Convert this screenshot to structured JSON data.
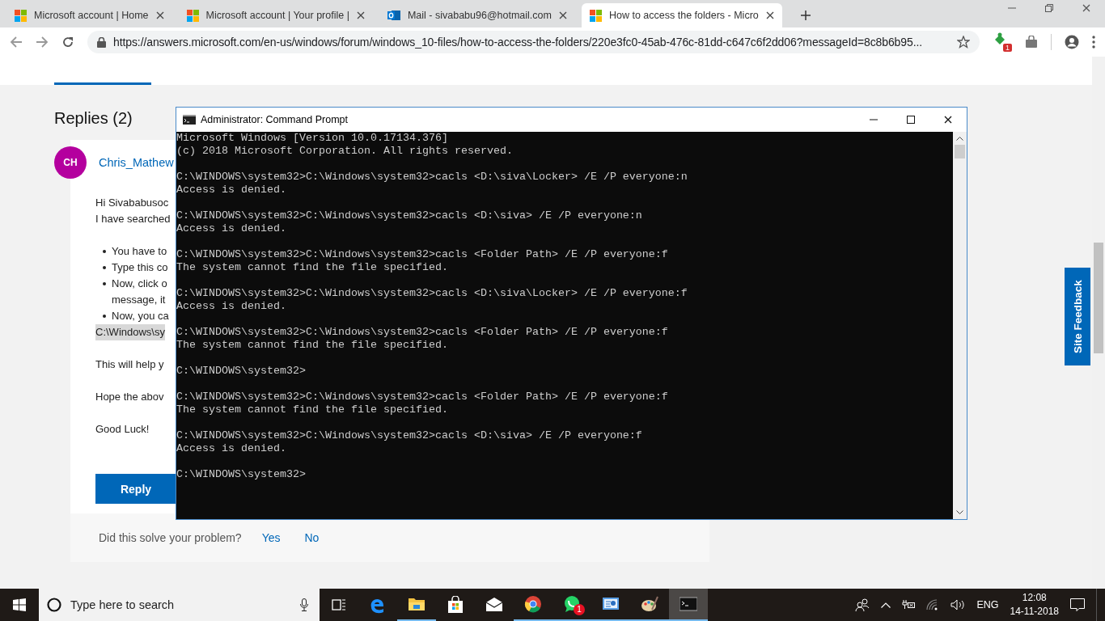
{
  "browser": {
    "tabs": [
      {
        "kind": "microsoft",
        "title": "Microsoft account | Home",
        "selected": false
      },
      {
        "kind": "microsoft",
        "title": "Microsoft account | Your profile |",
        "selected": false
      },
      {
        "kind": "mail",
        "title": "Mail - sivababu96@hotmail.com",
        "selected": false
      },
      {
        "kind": "microsoft",
        "title": "How to access the folders - Micro",
        "selected": true
      }
    ],
    "url": "https://answers.microsoft.com/en-us/windows/forum/windows_10-files/how-to-access-the-folders/220e3fc0-45ab-476c-81dd-c647c6f2dd06?messageId=8c8b6b95...",
    "extension_badge": "1"
  },
  "page": {
    "section_title": "Replies (2)",
    "reply": {
      "avatar_initials": "CH",
      "author": "Chris_Mathew",
      "blocks": [
        {
          "kind": "text",
          "lines": [
            "Hi Sivababusoc",
            "I have searched"
          ]
        },
        {
          "kind": "bullets",
          "items": [
            {
              "lines": [
                "You have to"
              ]
            },
            {
              "lines": [
                "Type this co"
              ]
            },
            {
              "lines": [
                "Now, click o",
                "message, it"
              ]
            },
            {
              "lines": [
                "Now, you ca"
              ]
            }
          ]
        },
        {
          "kind": "code",
          "lines": [
            "C:\\Windows\\sy"
          ]
        },
        {
          "kind": "text",
          "lines": [
            "This will help y"
          ]
        },
        {
          "kind": "text",
          "lines": [
            "Hope the abov"
          ]
        },
        {
          "kind": "text",
          "lines": [
            "Good Luck!"
          ]
        }
      ],
      "reply_button": "Reply",
      "feedback": {
        "question": "Did this solve your problem?",
        "yes": "Yes",
        "no": "No"
      }
    },
    "site_feedback": "Site Feedback"
  },
  "console": {
    "title": "Administrator: Command Prompt",
    "blocks": [
      [
        "Microsoft Windows [Version 10.0.17134.376]",
        "(c) 2018 Microsoft Corporation. All rights reserved."
      ],
      [
        "C:\\WINDOWS\\system32>C:\\Windows\\system32>cacls <D:\\siva\\Locker> /E /P everyone:n",
        "Access is denied."
      ],
      [
        "C:\\WINDOWS\\system32>C:\\Windows\\system32>cacls <D:\\siva> /E /P everyone:n",
        "Access is denied."
      ],
      [
        "C:\\WINDOWS\\system32>C:\\Windows\\system32>cacls <Folder Path> /E /P everyone:f",
        "The system cannot find the file specified."
      ],
      [
        "C:\\WINDOWS\\system32>C:\\Windows\\system32>cacls <D:\\siva\\Locker> /E /P everyone:f",
        "Access is denied."
      ],
      [
        "C:\\WINDOWS\\system32>C:\\Windows\\system32>cacls <Folder Path> /E /P everyone:f",
        "The system cannot find the file specified."
      ],
      [
        "C:\\WINDOWS\\system32>"
      ],
      [
        "C:\\WINDOWS\\system32>C:\\Windows\\system32>cacls <Folder Path> /E /P everyone:f",
        "The system cannot find the file specified."
      ],
      [
        "C:\\WINDOWS\\system32>C:\\Windows\\system32>cacls <D:\\siva> /E /P everyone:f",
        "Access is denied."
      ],
      [
        "C:\\WINDOWS\\system32>"
      ]
    ]
  },
  "taskbar": {
    "search_placeholder": "Type here to search",
    "apps": [
      {
        "kind": "edge",
        "running": false,
        "active": false
      },
      {
        "kind": "explorer",
        "running": true,
        "active": false
      },
      {
        "kind": "store",
        "running": false,
        "active": false
      },
      {
        "kind": "mail",
        "running": false,
        "active": false
      },
      {
        "kind": "chrome",
        "running": true,
        "active": false
      },
      {
        "kind": "whatsapp",
        "running": true,
        "active": false,
        "badge": "1"
      },
      {
        "kind": "presentation",
        "running": true,
        "active": false
      },
      {
        "kind": "paint",
        "running": true,
        "active": false
      },
      {
        "kind": "console",
        "running": true,
        "active": true
      }
    ],
    "language": "ENG",
    "time": "12:08",
    "date": "14-11-2018"
  }
}
